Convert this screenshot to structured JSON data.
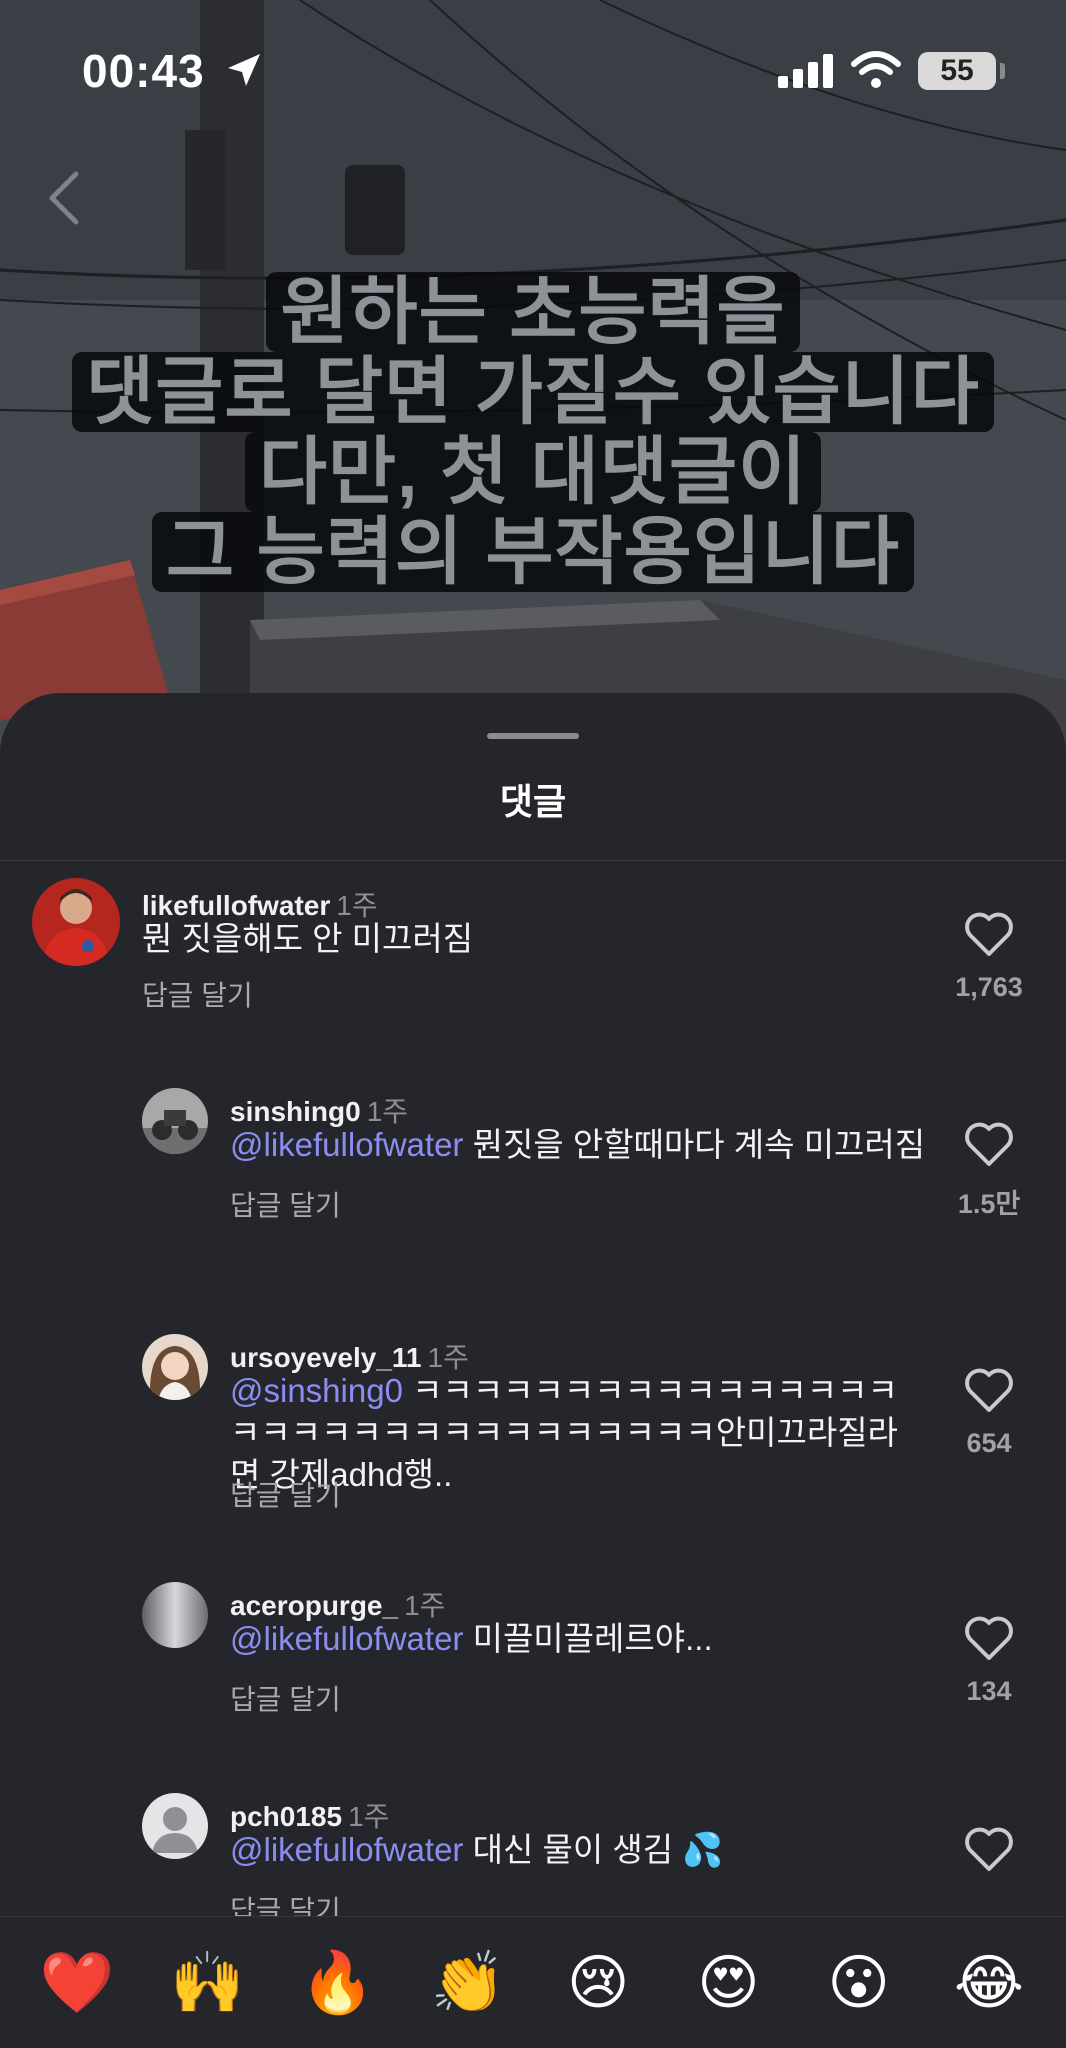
{
  "status_bar": {
    "time": "00:43",
    "battery": "55"
  },
  "caption_lines": [
    "원하는 초능력을",
    "댓글로 달면 가질수 있습니다",
    "다만, 첫 대댓글이",
    "그 능력의 부작용입니다"
  ],
  "sheet": {
    "title": "댓글"
  },
  "comments": [
    {
      "username": "likefullofwater",
      "time": "1주",
      "mention": "",
      "text": "뭔 짓을해도 안 미끄러짐",
      "reply": "답글 달기",
      "likes": "1,763"
    },
    {
      "username": "sinshing0",
      "time": "1주",
      "mention": "@likefullofwater",
      "text": " 뭔짓을 안할때마다 계속 미끄러짐",
      "reply": "답글 달기",
      "likes": "1.5만"
    },
    {
      "username": "ursoyevely_11",
      "time": "1주",
      "mention": "@sinshing0",
      "text": " ㅋㅋㅋㅋㅋㅋㅋㅋㅋㅋㅋㅋㅋㅋㅋㅋㅋㅋㅋㅋㅋㅋㅋㅋㅋㅋㅋㅋㅋㅋㅋㅋ안미끄라질라면 강제adhd행..",
      "reply": "답글 달기",
      "likes": "654"
    },
    {
      "username": "aceropurge_",
      "time": "1주",
      "mention": "@likefullofwater",
      "text": " 미끌미끌레르야...",
      "reply": "답글 달기",
      "likes": "134"
    },
    {
      "username": "pch0185",
      "time": "1주",
      "mention": "@likefullofwater",
      "text": " 대신 물이 생김 💦",
      "reply": "답글 달기",
      "likes": ""
    }
  ],
  "emoji_bar": [
    "❤️",
    "🙌",
    "🔥",
    "👏",
    "😢",
    "😍",
    "😮",
    "😂"
  ],
  "colors": {
    "sheet_bg": "#25262b",
    "mention": "#8b8ef0",
    "secondary_text": "#8d8f95"
  }
}
